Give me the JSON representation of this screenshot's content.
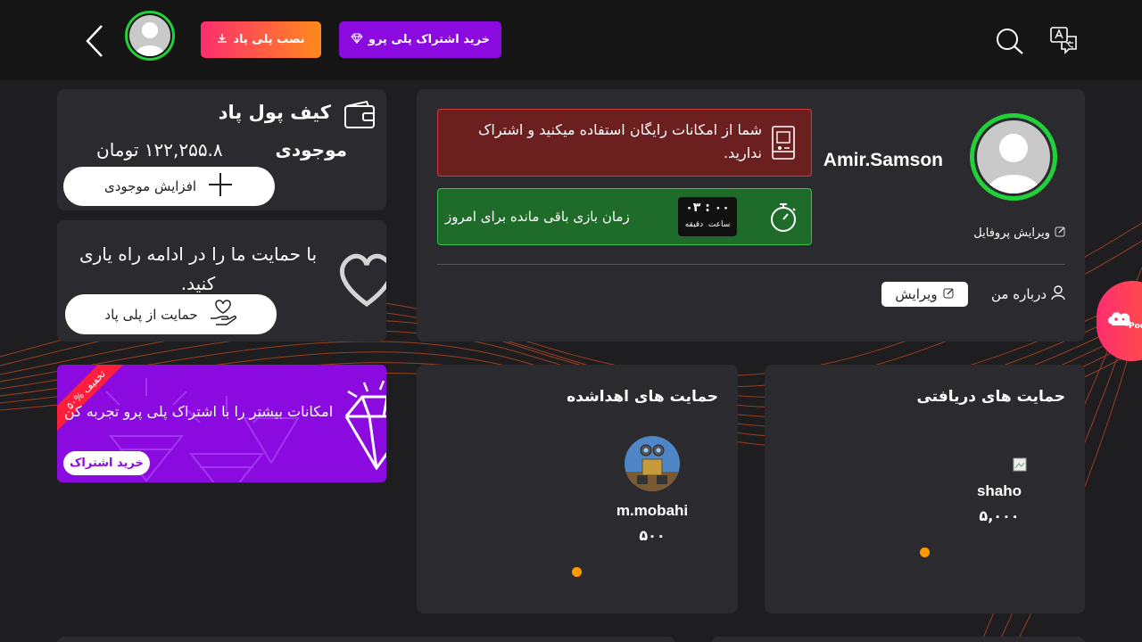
{
  "header": {
    "buy_pro_label": "خرید اشتراک پلی پرو",
    "install_label": "نصب پلی پاد"
  },
  "profile": {
    "username": "Amir.Samson",
    "edit_profile_label": "ویرایش پروفایل",
    "free_notice": "شما از امکانات رایگان استفاده میکنید و اشتراک ندارید.",
    "time_remaining_label": "زمان بازی باقی مانده برای امروز",
    "timer_value": "۰۳ : ۰۰",
    "timer_units": "ساعت  دقیقه",
    "about_label": "درباره من",
    "about_edit_label": "ویرایش"
  },
  "wallet": {
    "title": "کیف پول پاد",
    "balance_label": "موجودی",
    "balance_value": "۱۲۲,۲۵۵.۸ تومان",
    "increase_label": "افزایش موجودی"
  },
  "support": {
    "message": "با حمایت ما را در ادامه راه یاری کنید.",
    "button_label": "حمایت از پلی پاد"
  },
  "promo": {
    "ribbon": "تخفیف %۵۰",
    "message": "امکانات بیشتر را با اشتراک پلی پرو تجربه کن",
    "button_label": "خرید اشتراک"
  },
  "received": {
    "title": "حمایت های دریافتی",
    "items": [
      {
        "name": "shaho",
        "amount": "۵,۰۰۰"
      }
    ]
  },
  "given": {
    "title": "حمایت های اهداشده",
    "items": [
      {
        "name": "m.mobahi",
        "amount": "۵۰۰"
      }
    ]
  },
  "floating": {
    "badge_text": "Pod"
  },
  "colors": {
    "purple": "#8b0ae0",
    "gradient_start": "#ff2d6f",
    "gradient_end": "#ff8a1c",
    "avatar_ring": "#22d13a",
    "alert_red": "#6b1f1f",
    "alert_green": "#1f6b2a",
    "dot": "#ff9900"
  }
}
